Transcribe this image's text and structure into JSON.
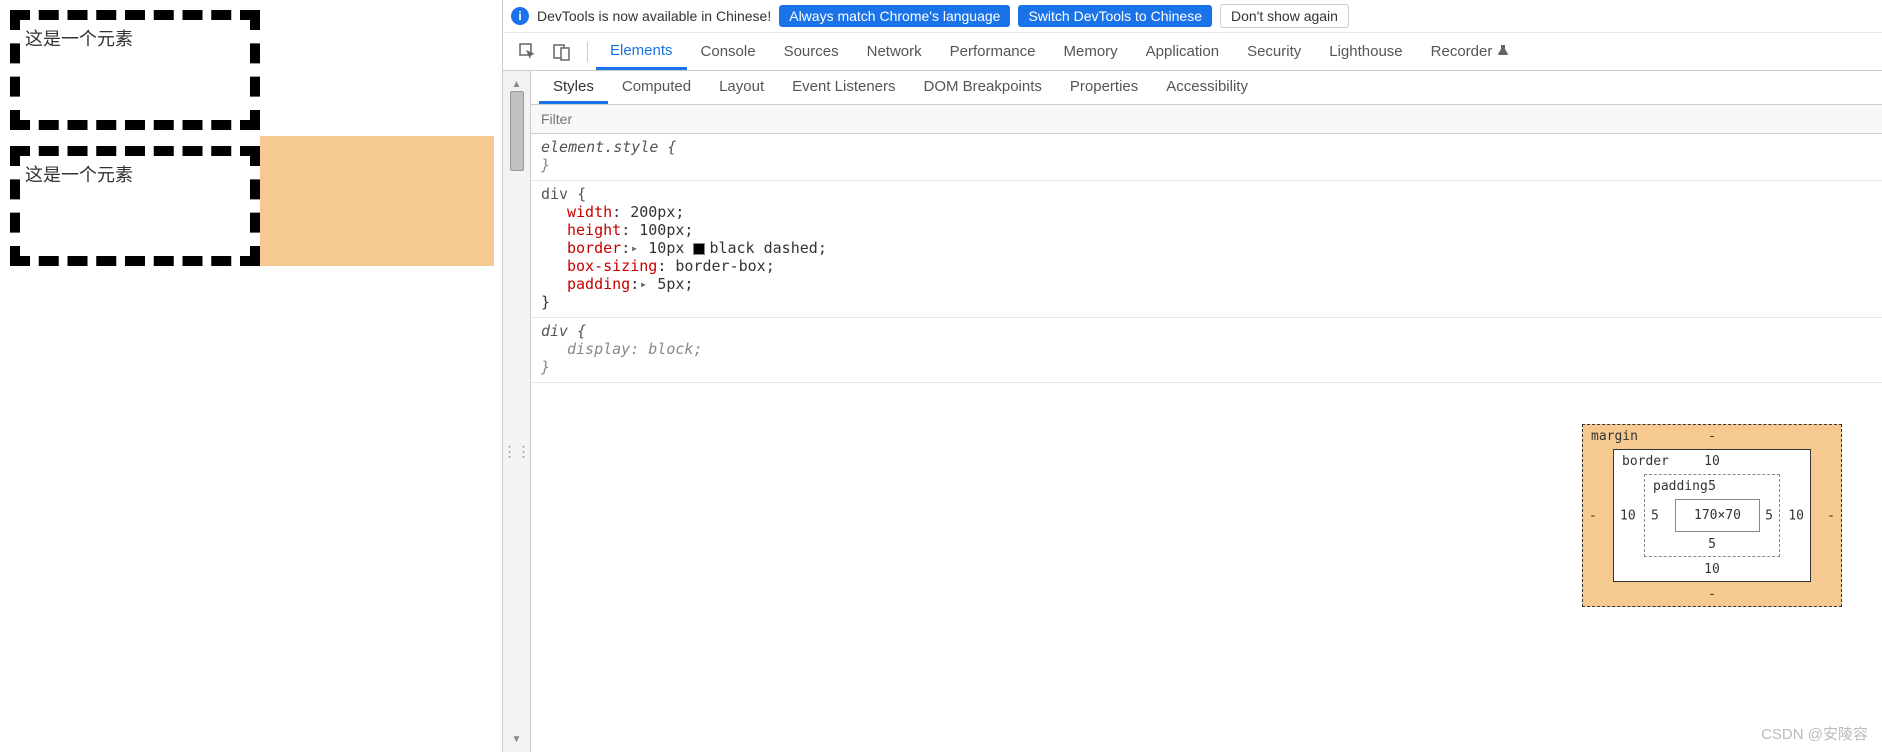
{
  "preview": {
    "box1_text": "这是一个元素",
    "box2_text": "这是一个元素"
  },
  "infobar": {
    "message": "DevTools is now available in Chinese!",
    "btn_always": "Always match Chrome's language",
    "btn_switch": "Switch DevTools to Chinese",
    "btn_dismiss": "Don't show again"
  },
  "main_tabs": [
    "Elements",
    "Console",
    "Sources",
    "Network",
    "Performance",
    "Memory",
    "Application",
    "Security",
    "Lighthouse",
    "Recorder"
  ],
  "main_tab_active": 0,
  "sub_tabs": [
    "Styles",
    "Computed",
    "Layout",
    "Event Listeners",
    "DOM Breakpoints",
    "Properties",
    "Accessibility"
  ],
  "sub_tab_active": 0,
  "filter_placeholder": "Filter",
  "rules": {
    "element_style_selector": "element.style {",
    "close_brace": "}",
    "div_selector": "div {",
    "props": {
      "width": {
        "name": "width",
        "value": "200px"
      },
      "height": {
        "name": "height",
        "value": "100px"
      },
      "border": {
        "name": "border",
        "value_px": "10px",
        "value_rest": "black dashed"
      },
      "boxsizing": {
        "name": "box-sizing",
        "value": "border-box"
      },
      "padding": {
        "name": "padding",
        "value": "5px"
      }
    },
    "ua_selector": "div {",
    "ua_prop": {
      "name": "display",
      "value": "block"
    }
  },
  "box_model": {
    "margin_label": "margin",
    "border_label": "border",
    "padding_label": "padding",
    "margin": {
      "top": "-",
      "right": "-",
      "bottom": "-",
      "left": "-"
    },
    "border": {
      "top": "10",
      "right": "10",
      "bottom": "10",
      "left": "10"
    },
    "padding": {
      "top": "5",
      "right": "5",
      "bottom": "5",
      "left": "5"
    },
    "content": "170×70"
  },
  "watermark": "CSDN @安陵容"
}
